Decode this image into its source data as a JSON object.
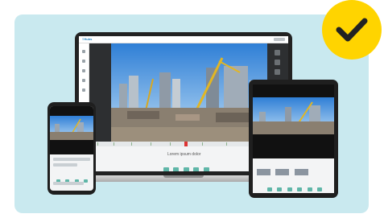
{
  "laptop": {
    "logo": "≡Hubs",
    "caption": "Lorem ipsum dolor"
  },
  "colors": {
    "panel": "#c9e9ef",
    "badge": "#ffd400",
    "accent": "#5fb6a8",
    "sky": "#3f8fe0"
  },
  "icons": {
    "badge": "checkmark-icon"
  }
}
